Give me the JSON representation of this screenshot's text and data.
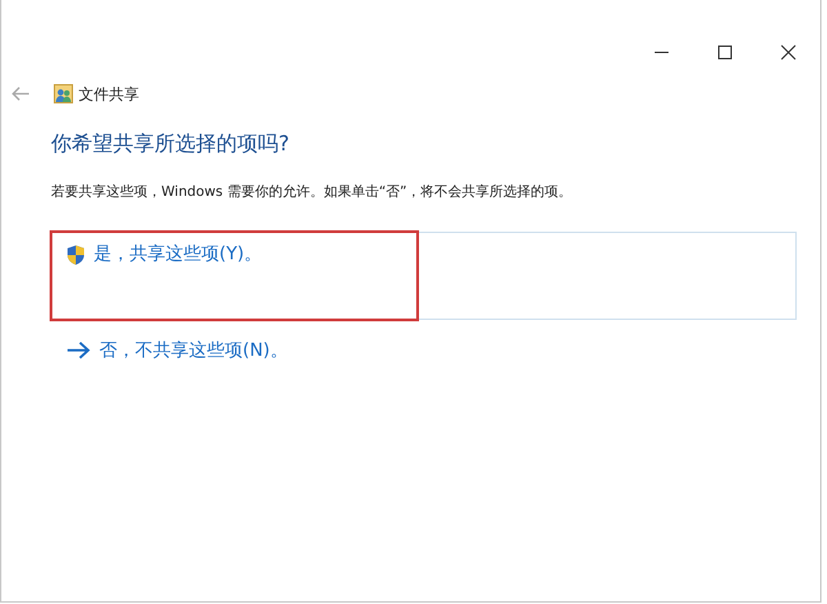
{
  "window": {
    "title": "文件共享"
  },
  "heading": "你希望共享所选择的项吗?",
  "description": "若要共享这些项，Windows 需要你的允许。如果单击“否”，将不会共享所选择的项。",
  "options": [
    {
      "kind": "shield",
      "label": "是，共享这些项(Y)。",
      "selected": true,
      "highlighted": true
    },
    {
      "kind": "arrow",
      "label": "否，不共享这些项(N)。",
      "selected": false,
      "highlighted": false
    }
  ]
}
